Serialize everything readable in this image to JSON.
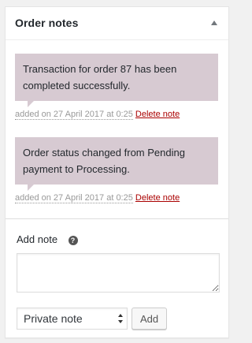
{
  "panel": {
    "title": "Order notes",
    "toggle_icon": "triangle-up-icon"
  },
  "notes": [
    {
      "text": "Transaction for order 87 has been completed successfully.",
      "added": "added on 27 April 2017 at 0:25",
      "delete_label": "Delete note"
    },
    {
      "text": "Order status changed from Pending payment to Processing.",
      "added": "added on 27 April 2017 at 0:25",
      "delete_label": "Delete note"
    }
  ],
  "add_note": {
    "label": "Add note",
    "help_glyph": "?",
    "textarea_value": "",
    "note_type_selected": "Private note",
    "add_button_label": "Add"
  },
  "colors": {
    "note_background": "#d7cad2",
    "delete_link": "#aa0000"
  }
}
